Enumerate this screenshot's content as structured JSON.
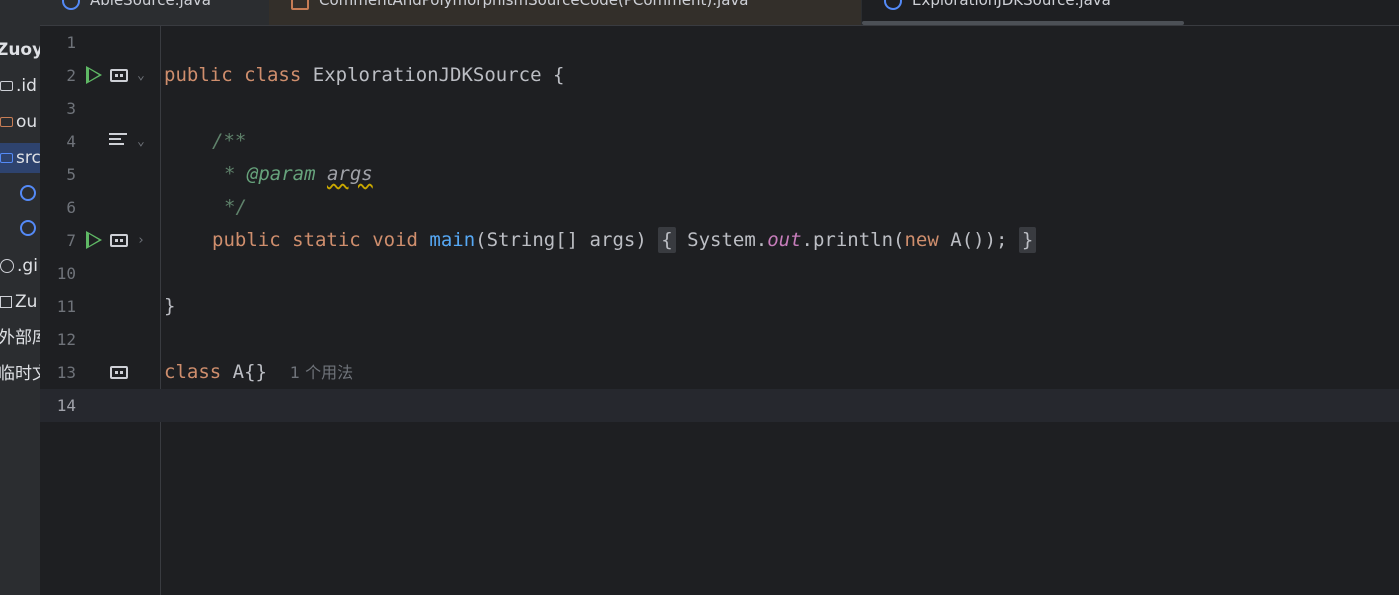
{
  "project": {
    "items": [
      {
        "label": "Zuoye",
        "icon": "none"
      },
      {
        "label": ".id",
        "icon": "folder-icon"
      },
      {
        "label": "ou",
        "icon": "folder-icon"
      },
      {
        "label": "src",
        "icon": "folder-icon"
      },
      {
        "label": "",
        "icon": "class-icon"
      },
      {
        "label": "",
        "icon": "class-icon"
      },
      {
        "label": ".gi",
        "icon": "gitignore-icon"
      },
      {
        "label": "Zu",
        "icon": "module-icon"
      },
      {
        "label": "外部库",
        "icon": "none"
      },
      {
        "label": "临时文",
        "icon": "none"
      }
    ]
  },
  "tabs": [
    {
      "label": "AbleSource.java"
    },
    {
      "label": "CommentAndPolymorphismSourceCode(PComment).java"
    },
    {
      "label": "ExplorationJDKSource.java"
    }
  ],
  "editor": {
    "line_numbers": [
      "1",
      "2",
      "3",
      "4",
      "5",
      "6",
      "7",
      "10",
      "11",
      "12",
      "13",
      "14"
    ],
    "code": {
      "l2_kw1": "public",
      "l2_kw2": "class",
      "l2_name": "ExplorationJDKSource",
      "l2_brace": "{",
      "l4": "/**",
      "l5_star": "* ",
      "l5_tag": "@param",
      "l5_arg": "args",
      "l6": "*/",
      "l7_kw1": "public",
      "l7_kw2": "static",
      "l7_kw3": "void",
      "l7_fn": "main",
      "l7_params": "(String[] args)",
      "l7_open": "{",
      "l7_sys": "System.",
      "l7_out": "out",
      "l7_print": ".println(",
      "l7_new": "new",
      "l7_rest": "A());",
      "l7_close": "}",
      "l11": "}",
      "l13_kw": "class",
      "l13_rest": "A{}",
      "l13_hint": "1 个用法"
    }
  }
}
